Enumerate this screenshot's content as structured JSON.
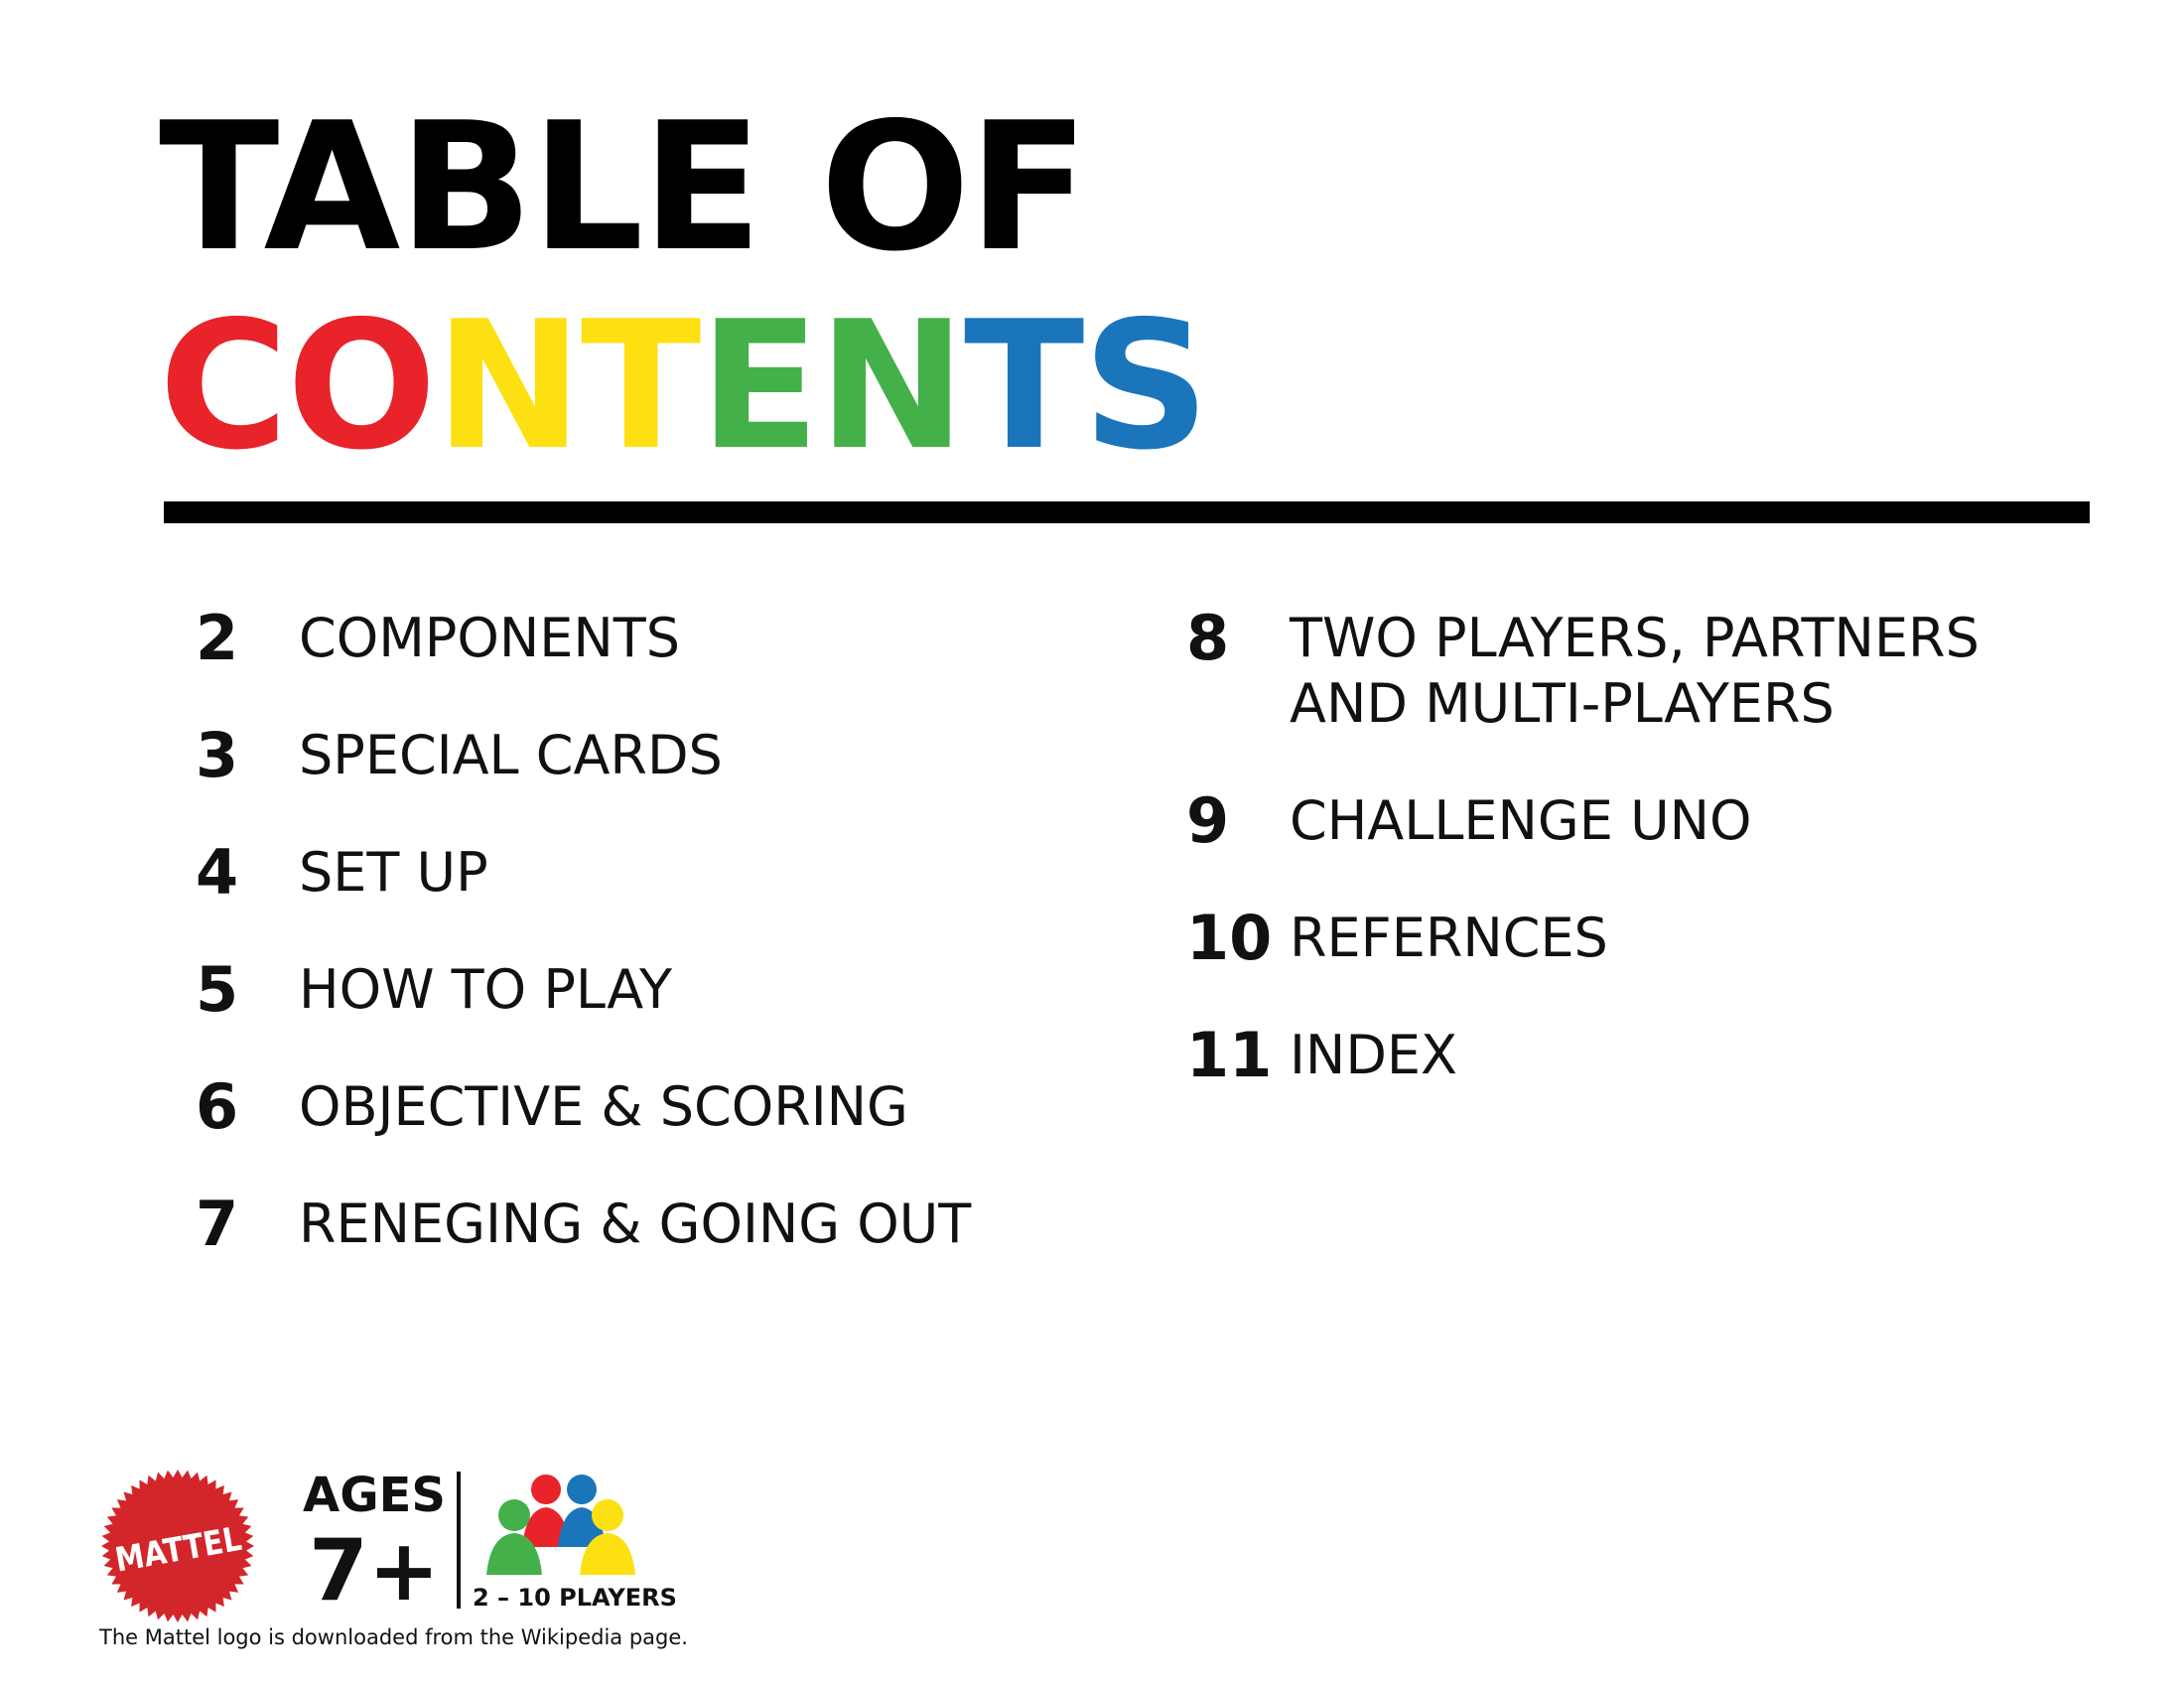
{
  "title": {
    "line1": "TABLE OF",
    "line2_letters": [
      {
        "char": "C",
        "color": "#e8232a"
      },
      {
        "char": "O",
        "color": "#e8232a"
      },
      {
        "char": "N",
        "color": "#fce011"
      },
      {
        "char": "T",
        "color": "#fce011"
      },
      {
        "char": "E",
        "color": "#43b04a"
      },
      {
        "char": "N",
        "color": "#43b04a"
      },
      {
        "char": "T",
        "color": "#1b75bb"
      },
      {
        "char": "S",
        "color": "#1b75bb"
      }
    ]
  },
  "toc": {
    "left": [
      {
        "num": "2",
        "title": "COMPONENTS"
      },
      {
        "num": "3",
        "title": "SPECIAL CARDS"
      },
      {
        "num": "4",
        "title": "SET UP"
      },
      {
        "num": "5",
        "title": "HOW TO PLAY"
      },
      {
        "num": "6",
        "title": "OBJECTIVE & SCORING"
      },
      {
        "num": "7",
        "title": "RENEGING & GOING OUT"
      }
    ],
    "right": [
      {
        "num": "8",
        "title": "TWO PLAYERS, PARTNERS AND MULTI-PLAYERS"
      },
      {
        "num": "9",
        "title": "CHALLENGE UNO"
      },
      {
        "num": "10",
        "title": "REFERNCES"
      },
      {
        "num": "11",
        "title": "INDEX"
      }
    ]
  },
  "footer": {
    "logo_text": "MATTEL",
    "logo_color": "#d2262b",
    "ages_label": "AGES",
    "ages_value": "7+",
    "players_label": "2 – 10 PLAYERS",
    "player_colors": [
      "#e8232a",
      "#1b75bb",
      "#43b04a",
      "#fce011"
    ],
    "logo_credit": "The Mattel logo is downloaded from the Wikipedia page."
  }
}
